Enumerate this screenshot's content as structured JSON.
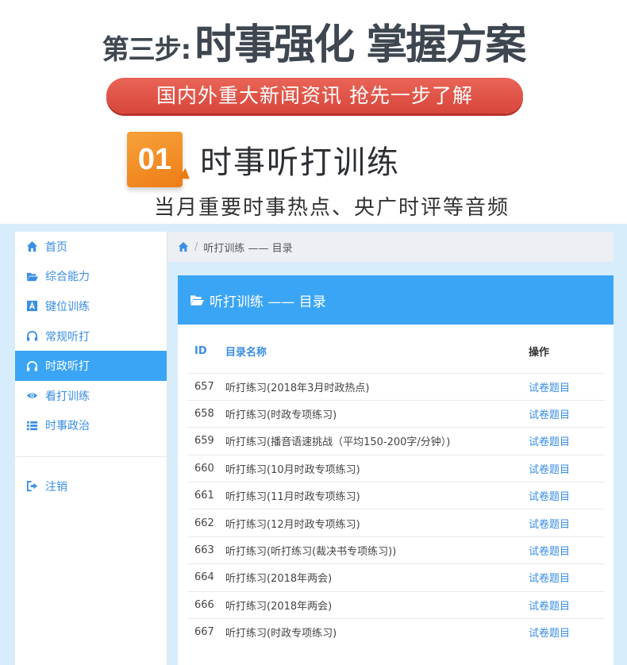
{
  "banner": {
    "step_prefix": "第三步:",
    "step_main": "时事强化 掌握方案",
    "pill_text": "国内外重大新闻资讯 抢先一步了解",
    "number": "01",
    "section_title": "时事听打训练",
    "section_sub": "当月重要时事热点、央广时评等音频"
  },
  "sidebar": {
    "items": [
      {
        "label": "首页",
        "icon": "home-icon"
      },
      {
        "label": "综合能力",
        "icon": "folder-open-icon"
      },
      {
        "label": "键位训练",
        "icon": "font-icon"
      },
      {
        "label": "常规听打",
        "icon": "headphones-icon"
      },
      {
        "label": "时政听打",
        "icon": "headphones-icon",
        "active": true
      },
      {
        "label": "看打训练",
        "icon": "eye-icon"
      },
      {
        "label": "时事政治",
        "icon": "list-icon"
      }
    ],
    "logout": {
      "label": "注销",
      "icon": "logout-icon"
    }
  },
  "breadcrumb": {
    "text": "听打训练 —— 目录"
  },
  "panel": {
    "title": "听打训练 —— 目录",
    "columns": {
      "id": "ID",
      "name": "目录名称",
      "op": "操作"
    },
    "rows": [
      {
        "id": "657",
        "name": "听打练习(2018年3月时政热点)",
        "op": "试卷题目"
      },
      {
        "id": "658",
        "name": "听打练习(时政专项练习)",
        "op": "试卷题目"
      },
      {
        "id": "659",
        "name": "听打练习(播音语速挑战（平均150-200字/分钟）)",
        "op": "试卷题目"
      },
      {
        "id": "660",
        "name": "听打练习(10月时政专项练习)",
        "op": "试卷题目"
      },
      {
        "id": "661",
        "name": "听打练习(11月时政专项练习)",
        "op": "试卷题目"
      },
      {
        "id": "662",
        "name": "听打练习(12月时政专项练习)",
        "op": "试卷题目"
      },
      {
        "id": "663",
        "name": "听打练习(听打练习(裁决书专项练习))",
        "op": "试卷题目"
      },
      {
        "id": "664",
        "name": "听打练习(2018年两会)",
        "op": "试卷题目"
      },
      {
        "id": "666",
        "name": "听打练习(2018年两会)",
        "op": "试卷题目"
      },
      {
        "id": "667",
        "name": "听打练习(时政专项练习)",
        "op": "试卷题目"
      }
    ]
  },
  "colors": {
    "accent": "#3ba5f5",
    "link": "#3a8ee6",
    "pill": "#d8463b",
    "badge": "#f08a1f",
    "frame_bg": "#d8edfb"
  }
}
